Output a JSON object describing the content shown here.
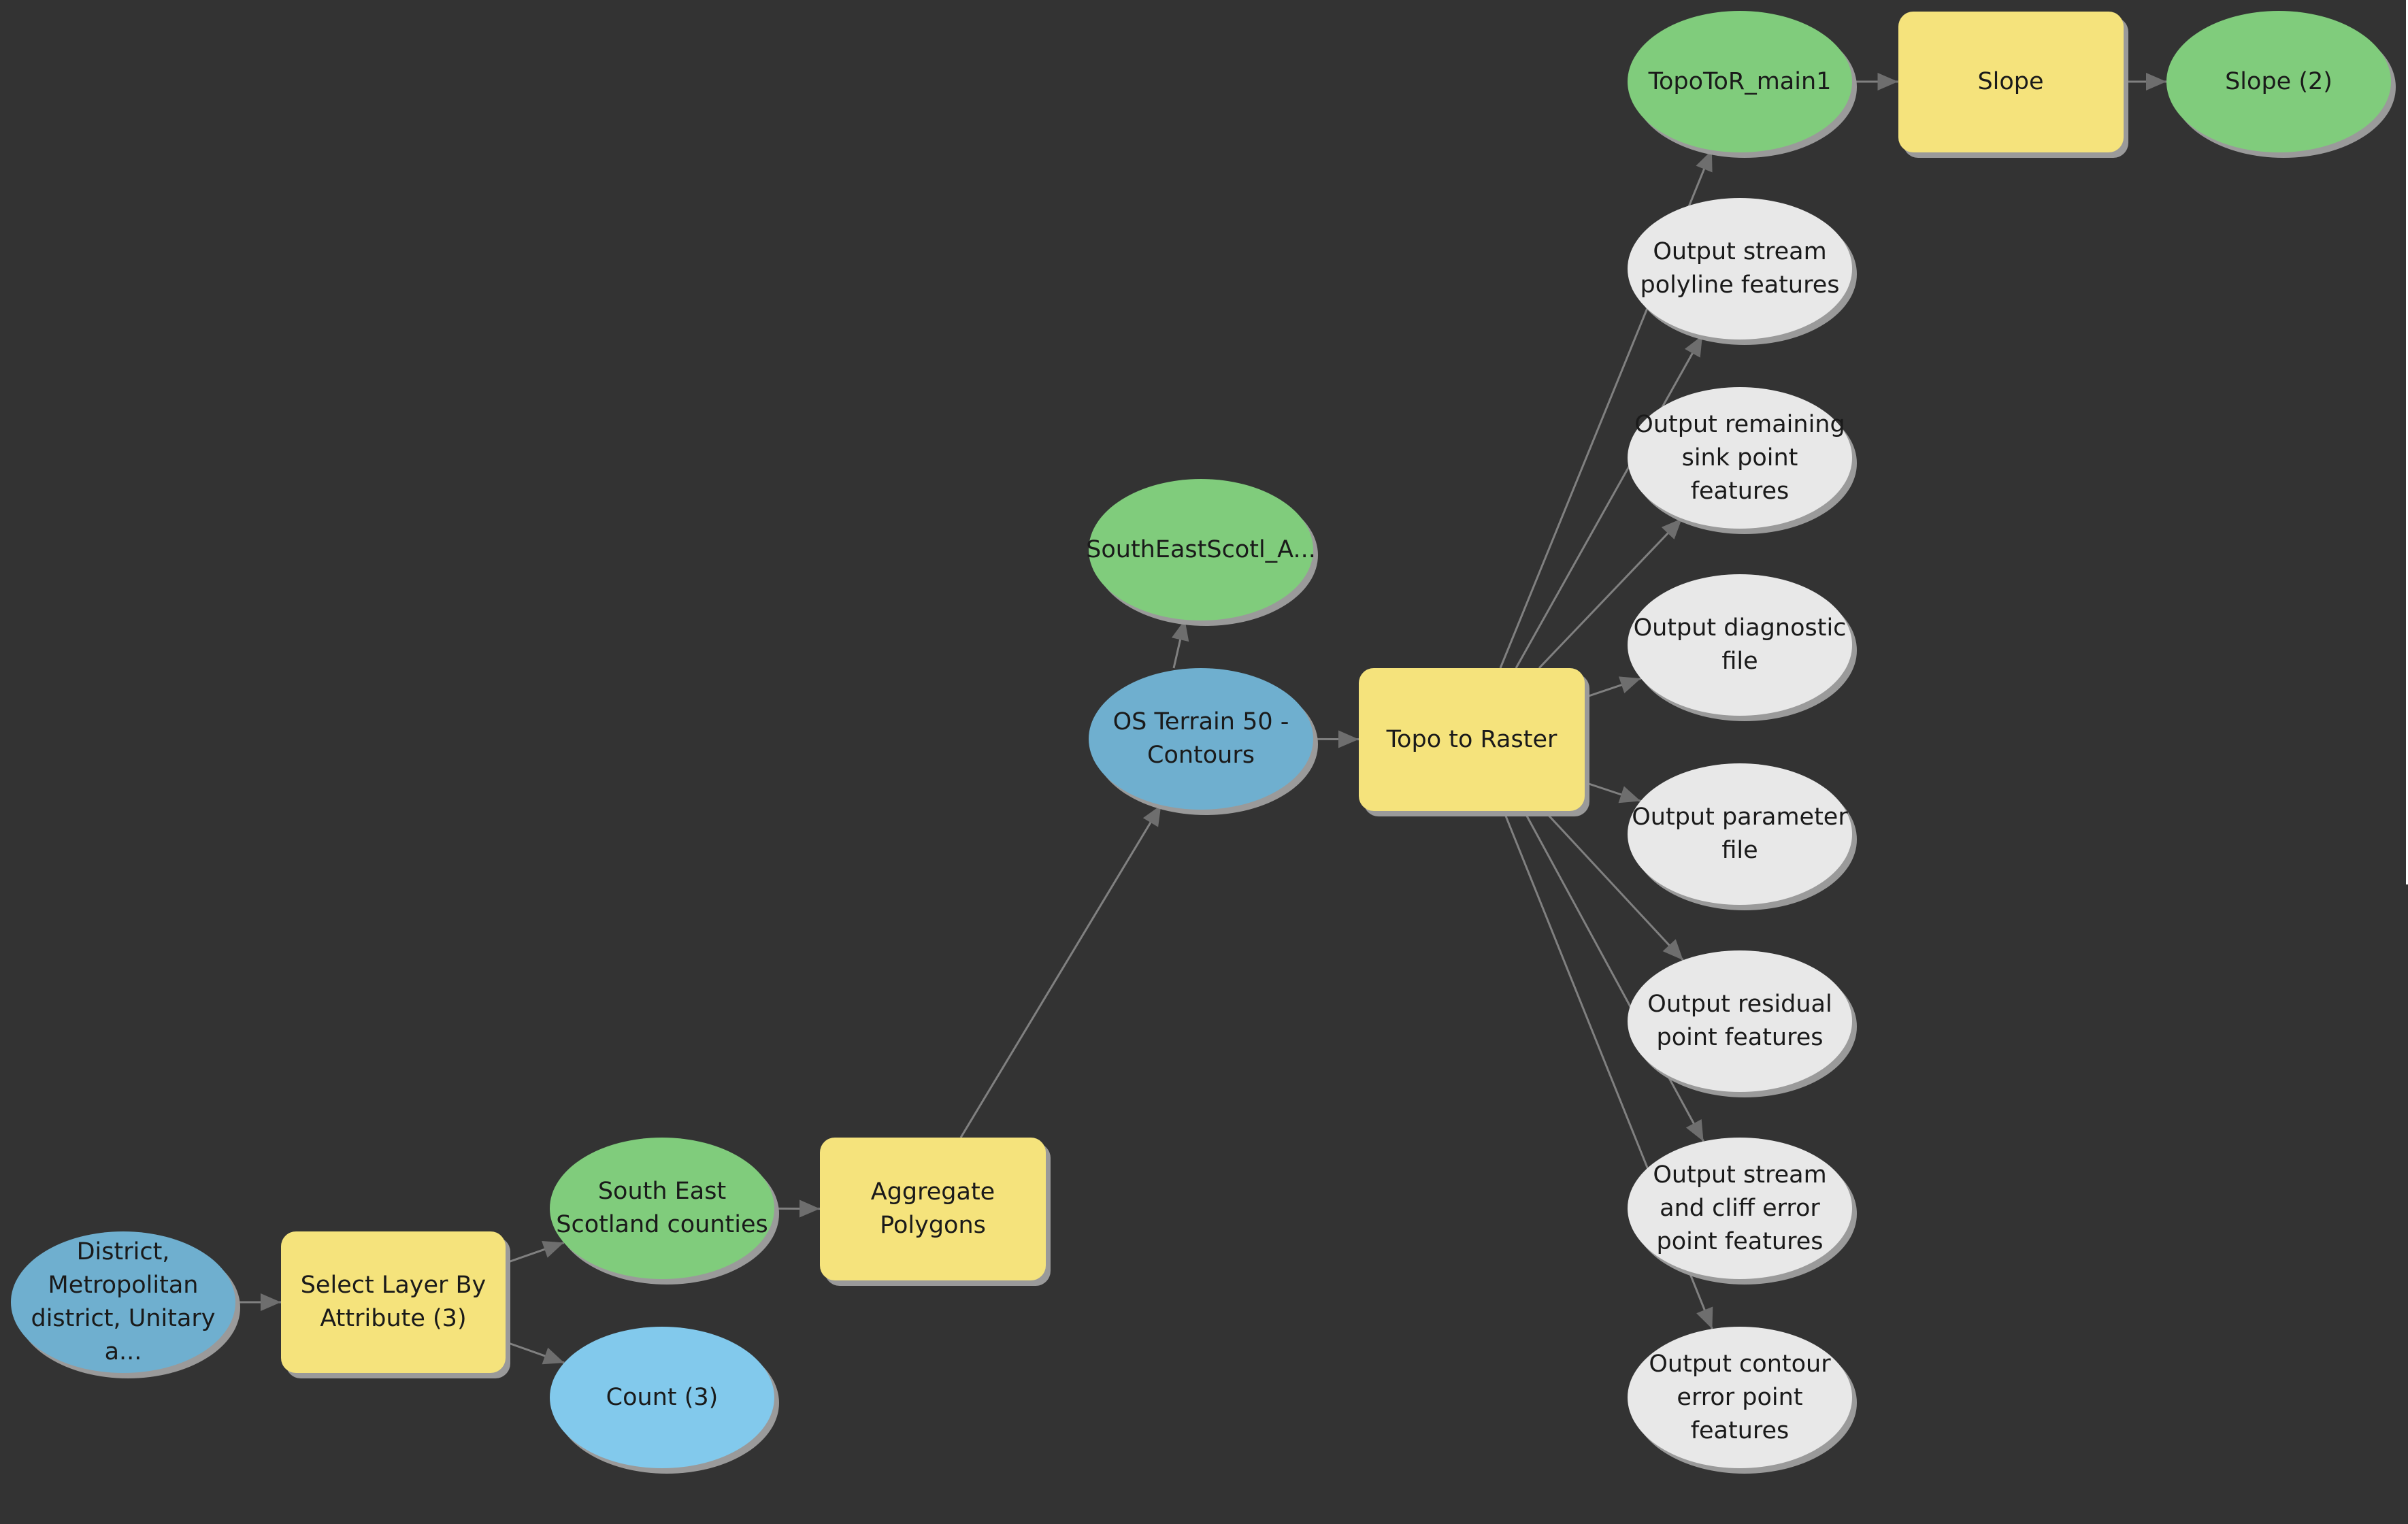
{
  "app": {
    "view": "ModelBuilder diagram",
    "background_color": "#333333"
  },
  "colors": {
    "input_data": "#6fafcf",
    "tool": "#f5e37c",
    "derived_data": "#80cc7c",
    "variable": "#82c9ec",
    "optional_output": "#e8e8e8",
    "connector": "#808080",
    "shadow": "#9a9a9a"
  },
  "nodes": [
    {
      "id": "district",
      "type": "input_data",
      "shape": "ellipse",
      "label": "District,\nMetropolitan\ndistrict, Unitary a..."
    },
    {
      "id": "select_layer",
      "type": "tool",
      "shape": "box",
      "label": "Select Layer By\nAttribute (3)"
    },
    {
      "id": "se_scotland_counties",
      "type": "derived_data",
      "shape": "ellipse",
      "label": "South East\nScotland counties"
    },
    {
      "id": "count3",
      "type": "variable",
      "shape": "ellipse",
      "label": "Count (3)"
    },
    {
      "id": "aggregate_polygons",
      "type": "tool",
      "shape": "box",
      "label": "Aggregate\nPolygons"
    },
    {
      "id": "southeastscotl_a",
      "type": "derived_data",
      "shape": "ellipse",
      "label": "SouthEastScotl_A..."
    },
    {
      "id": "os_terrain",
      "type": "input_data",
      "shape": "ellipse",
      "label": "OS Terrain 50 -\nContours"
    },
    {
      "id": "topo_to_raster",
      "type": "tool",
      "shape": "box",
      "label": "Topo to Raster"
    },
    {
      "id": "topotor_main1",
      "type": "derived_data",
      "shape": "ellipse",
      "label": "TopoToR_main1"
    },
    {
      "id": "slope",
      "type": "tool",
      "shape": "box",
      "label": "Slope"
    },
    {
      "id": "slope2",
      "type": "derived_data",
      "shape": "ellipse",
      "label": "Slope (2)"
    },
    {
      "id": "out_stream_polyline",
      "type": "optional_output",
      "shape": "ellipse",
      "label": "Output stream\npolyline features"
    },
    {
      "id": "out_sink",
      "type": "optional_output",
      "shape": "ellipse",
      "label": "Output remaining\nsink point features"
    },
    {
      "id": "out_diagnostic",
      "type": "optional_output",
      "shape": "ellipse",
      "label": "Output diagnostic\nfile"
    },
    {
      "id": "out_parameter",
      "type": "optional_output",
      "shape": "ellipse",
      "label": "Output parameter\nfile"
    },
    {
      "id": "out_residual",
      "type": "optional_output",
      "shape": "ellipse",
      "label": "Output residual\npoint features"
    },
    {
      "id": "out_stream_cliff",
      "type": "optional_output",
      "shape": "ellipse",
      "label": "Output stream\nand cliff error\npoint features"
    },
    {
      "id": "out_contour_error",
      "type": "optional_output",
      "shape": "ellipse",
      "label": "Output contour\nerror point\nfeatures"
    }
  ],
  "edges": [
    {
      "from": "district",
      "to": "select_layer"
    },
    {
      "from": "select_layer",
      "to": "se_scotland_counties"
    },
    {
      "from": "select_layer",
      "to": "count3"
    },
    {
      "from": "se_scotland_counties",
      "to": "aggregate_polygons"
    },
    {
      "from": "aggregate_polygons",
      "to": "os_terrain"
    },
    {
      "from": "os_terrain",
      "to": "southeastscotl_a"
    },
    {
      "from": "os_terrain",
      "to": "topo_to_raster"
    },
    {
      "from": "topo_to_raster",
      "to": "topotor_main1"
    },
    {
      "from": "topo_to_raster",
      "to": "out_stream_polyline"
    },
    {
      "from": "topo_to_raster",
      "to": "out_sink"
    },
    {
      "from": "topo_to_raster",
      "to": "out_diagnostic"
    },
    {
      "from": "topo_to_raster",
      "to": "out_parameter"
    },
    {
      "from": "topo_to_raster",
      "to": "out_residual"
    },
    {
      "from": "topo_to_raster",
      "to": "out_stream_cliff"
    },
    {
      "from": "topo_to_raster",
      "to": "out_contour_error"
    },
    {
      "from": "topotor_main1",
      "to": "slope"
    },
    {
      "from": "slope",
      "to": "slope2"
    }
  ]
}
